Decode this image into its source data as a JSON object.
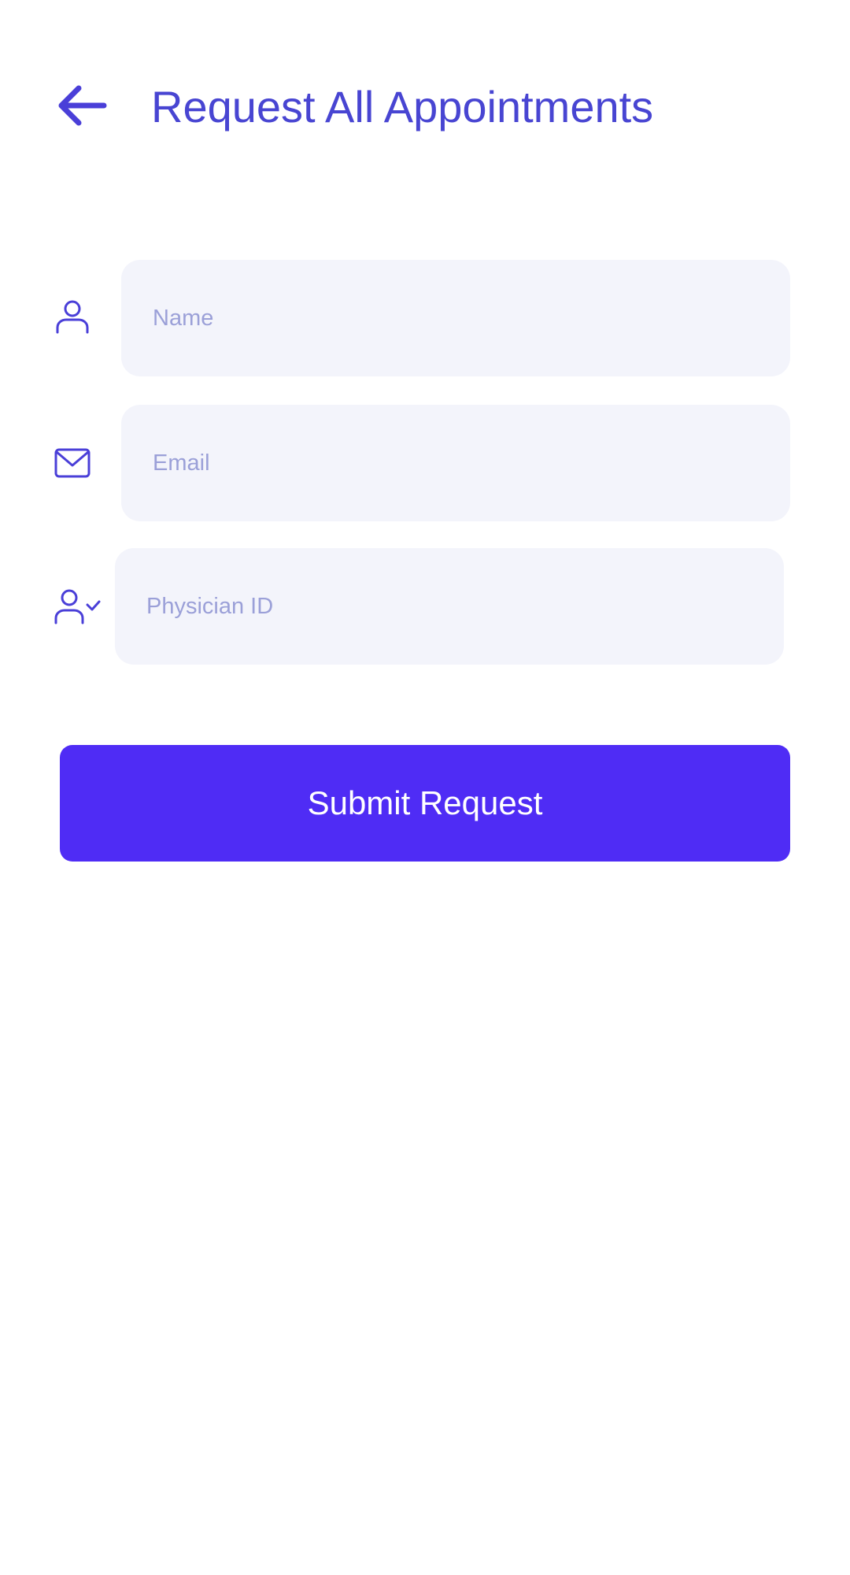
{
  "header": {
    "back_icon": "arrow-left-icon",
    "title": "Request All Appointments"
  },
  "form": {
    "name": {
      "icon": "user-icon",
      "placeholder": "Name",
      "value": ""
    },
    "email": {
      "icon": "envelope-icon",
      "placeholder": "Email",
      "value": ""
    },
    "physician_id": {
      "icon": "user-check-icon",
      "placeholder": "Physician ID",
      "value": ""
    },
    "submit_label": "Submit Request"
  },
  "colors": {
    "accent": "#4845d2",
    "button": "#4f2cf5",
    "field_background": "#f3f4fb",
    "placeholder": "#9ba0d8"
  }
}
